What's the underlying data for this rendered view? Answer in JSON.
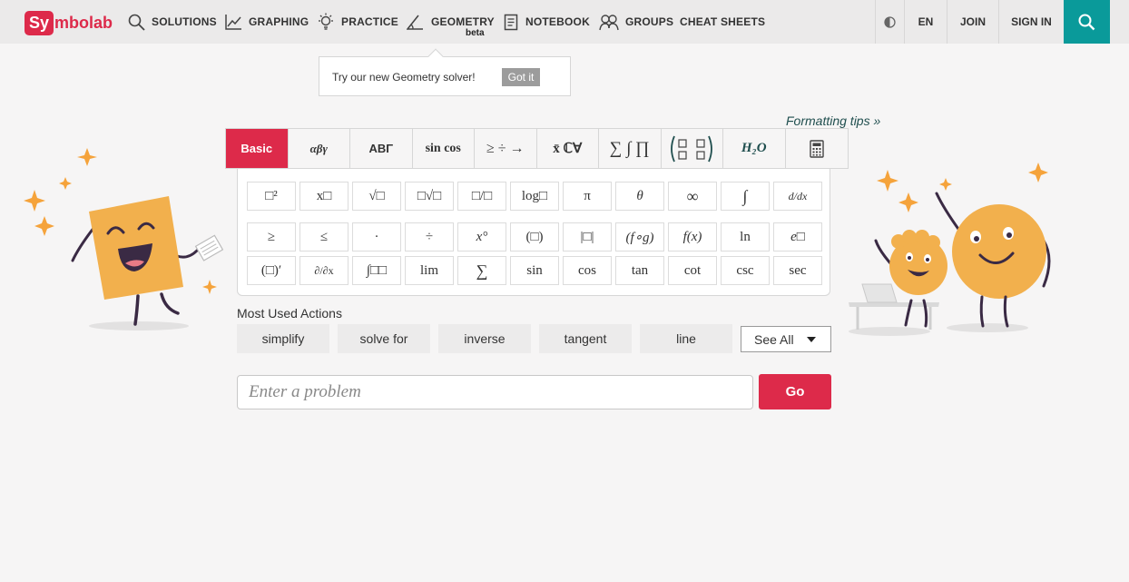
{
  "header": {
    "logo_prefix": "Sy",
    "logo_suffix": "mbolab",
    "nav": [
      {
        "label": "SOLUTIONS",
        "icon": "search-icon"
      },
      {
        "label": "GRAPHING",
        "icon": "graph-icon"
      },
      {
        "label": "PRACTICE",
        "icon": "lightbulb-icon"
      },
      {
        "label": "GEOMETRY",
        "icon": "angle-icon"
      },
      {
        "label": "NOTEBOOK",
        "icon": "notebook-icon"
      },
      {
        "label": "GROUPS",
        "icon": "groups-icon"
      },
      {
        "label": "CHEAT SHEETS"
      }
    ],
    "geometry_badge": "beta",
    "language": "EN",
    "join": "JOIN",
    "sign_in": "SIGN IN",
    "colors": {
      "brand": "#dd2a4a",
      "search_bg": "#0a9a9a"
    }
  },
  "tooltip": {
    "message": "Try our new Geometry solver!",
    "button": "Got it"
  },
  "formatting_tips": "Formatting tips »",
  "tabs": {
    "basic": "Basic",
    "greek": "αβγ",
    "capital_greek": "ΑΒΓ",
    "trig": "sin cos",
    "operators": "≥ ÷ →",
    "sets": "x̄ ℂ∀",
    "sums": "∑ ∫ ∏",
    "chem": "H₂O"
  },
  "keypad": {
    "row1": [
      "□²",
      "x□",
      "√□",
      "□√□",
      "□/□",
      "log□",
      "π",
      "θ",
      "∞",
      "∫",
      "d/dx"
    ],
    "row2": [
      "≥",
      "≤",
      "·",
      "÷",
      "x°",
      "(□)",
      "|□|",
      "(f∘g)",
      "f(x)",
      "ln",
      "e□"
    ],
    "row3": [
      "(□)′",
      "∂/∂x",
      "∫□□",
      "lim",
      "∑",
      "sin",
      "cos",
      "tan",
      "cot",
      "csc",
      "sec"
    ]
  },
  "most_used": {
    "title": "Most Used Actions",
    "actions": [
      "simplify",
      "solve for",
      "inverse",
      "tangent",
      "line"
    ],
    "see_all": "See All"
  },
  "problem_input": {
    "placeholder": "Enter a problem",
    "go": "Go"
  }
}
